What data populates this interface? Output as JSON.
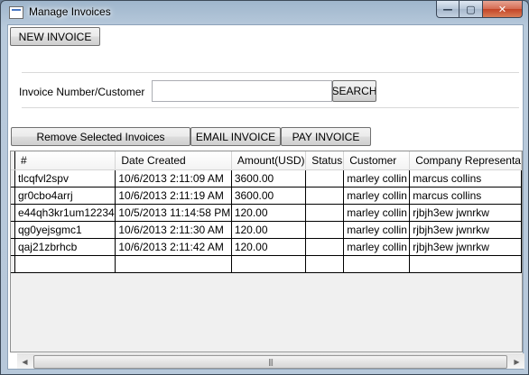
{
  "window": {
    "title": "Manage Invoices",
    "minimize_glyph": "—",
    "maximize_glyph": "▢",
    "close_glyph": "✕"
  },
  "toolbar": {
    "new_invoice_label": "NEW INVOICE"
  },
  "search": {
    "label": "Invoice Number/Customer",
    "value": "",
    "placeholder": "",
    "button_label": "SEARCH"
  },
  "actions": {
    "remove_label": "Remove Selected Invoices",
    "email_label": "EMAIL INVOICE",
    "pay_label": "PAY INVOICE"
  },
  "table": {
    "columns": [
      "#",
      "Date Created",
      "Amount(USD)",
      "Status",
      "Customer",
      "Company Representa"
    ],
    "rows": [
      [
        "tlcqfvl2spv",
        "10/6/2013 2:11:09 AM",
        "3600.00",
        "",
        "marley collin",
        "marcus collins"
      ],
      [
        "gr0cbo4arrj",
        "10/6/2013 2:11:19 AM",
        "3600.00",
        "",
        "marley collin",
        "marcus collins"
      ],
      [
        "e44qh3kr1um12234",
        "10/5/2013 11:14:58 PM",
        "120.00",
        "",
        "marley collin",
        "rjbjh3ew jwnrkw"
      ],
      [
        "qg0yejsgmc1",
        "10/6/2013 2:11:30 AM",
        "120.00",
        "",
        "marley collin",
        "rjbjh3ew jwnrkw"
      ],
      [
        "qaj21zbrhcb",
        "10/6/2013 2:11:42 AM",
        "120.00",
        "",
        "marley collin",
        "rjbjh3ew jwnrkw"
      ],
      [
        "",
        "",
        "",
        "",
        "",
        ""
      ]
    ]
  },
  "scrollbar": {
    "left_arrow": "◀",
    "right_arrow": "▶",
    "grip": "|||"
  }
}
